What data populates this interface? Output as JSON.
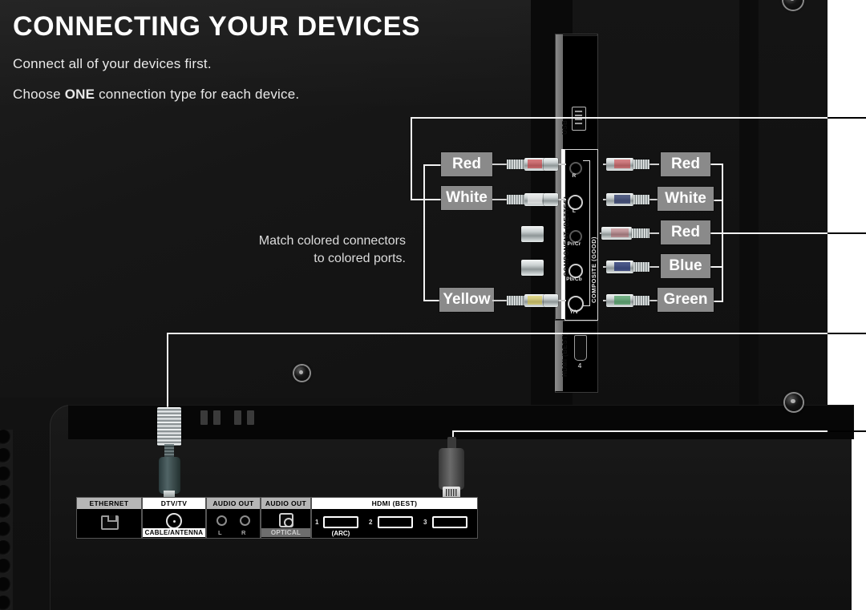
{
  "header": {
    "title": "CONNECTING YOUR DEVICES",
    "line1": "Connect all of your devices first.",
    "line2_before": "Choose ",
    "line2_bold": "ONE",
    "line2_after": " connection type for each device."
  },
  "middle_note": {
    "line1": "Match colored connectors",
    "line2": "to colored ports."
  },
  "left_connector_labels": [
    {
      "label": "Red",
      "color": "#cc2127"
    },
    {
      "label": "White",
      "color": "#e8e8e8"
    },
    {
      "label": "Yellow",
      "color": "#e3c81f"
    }
  ],
  "right_connector_labels": [
    {
      "label": "Red",
      "color": "#cc2127"
    },
    {
      "label": "White",
      "color": "#1d2a5e"
    },
    {
      "label": "Red",
      "color": "#b03038"
    },
    {
      "label": "Blue",
      "color": "#1b2a6b"
    },
    {
      "label": "Green",
      "color": "#2f8f48"
    }
  ],
  "side_io": {
    "usb_label": "USB",
    "component_label": "COMPONENT (BETTER)",
    "composite_label": "COMPOSITE (GOOD)",
    "hdmi_label": "HDMI (BEST)",
    "hdmi_port_number": "4",
    "ports": [
      {
        "cap": "R"
      },
      {
        "cap": "L"
      },
      {
        "cap": "Pr/Cr"
      },
      {
        "cap": "Pb/Cb"
      },
      {
        "cap": "Y/V"
      }
    ]
  },
  "bottom_io": {
    "cells": [
      {
        "head": "ETHERNET",
        "foot": ""
      },
      {
        "head": "DTV/TV",
        "foot": "CABLE/ANTENNA"
      },
      {
        "head": "AUDIO OUT",
        "foot": "",
        "sub_left": "L",
        "sub_right": "R"
      },
      {
        "head": "AUDIO OUT",
        "foot": "OPTICAL"
      },
      {
        "head": "HDMI (BEST)",
        "foot": ""
      }
    ],
    "hdmi_numbers": [
      "1",
      "2",
      "3"
    ],
    "hdmi_arc_label": "(ARC)"
  },
  "colors": {
    "chip_bg": "#8a8a8a",
    "callout_line": "#f2f2f2",
    "panel_bg": "#121212",
    "callout_field": "#ffffff"
  }
}
